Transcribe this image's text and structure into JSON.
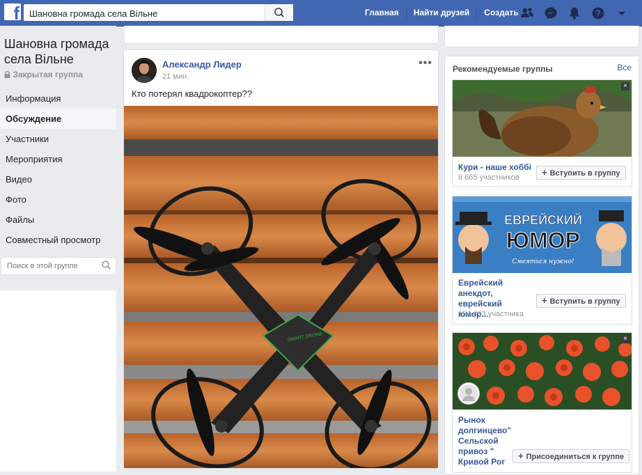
{
  "topbar": {
    "logo": "f",
    "search_value": "Шановна громада села Вільне",
    "nav": [
      "Главная",
      "Найти друзей",
      "Создать"
    ],
    "icons": [
      "friends-icon",
      "messenger-icon",
      "notifications-icon",
      "help-icon",
      "dropdown-icon"
    ]
  },
  "sidebar": {
    "group_title": "Шановна громада села Вільне",
    "group_type": "Закрытая группа",
    "menu": [
      "Информация",
      "Обсуждение",
      "Участники",
      "Мероприятия",
      "Видео",
      "Фото",
      "Файлы",
      "Совместный просмотр"
    ],
    "active_item": "Обсуждение",
    "search_placeholder": "Поиск в этой группе"
  },
  "post": {
    "author": "Александр Лидер",
    "timestamp": "21 мин.",
    "text": "Кто потерял квадрокоптер??",
    "more": "•••",
    "photo_label": "SMART DRONE"
  },
  "recommended": {
    "title": "Рекомендуемые группы",
    "see_all": "Все",
    "cards": [
      {
        "name": "Кури - наше хоббі",
        "members": "6 665 участников",
        "join": "Вступить в группу"
      },
      {
        "name": "Еврейский анекдот, еврейский юмор...",
        "members": "154 403 участника",
        "join": "Вступить в группу",
        "banner_title_1": "ЕВРЕЙСКИЙ",
        "banner_title_2": "ЮМОР",
        "banner_sub": "Смеяться нужно!"
      },
      {
        "name": "Рынок долгинцево\" Сельской привоз \" Кривой Рог",
        "join": "Присоединиться к группе"
      }
    ]
  },
  "colors": {
    "brand": "#4267b2",
    "link": "#365899",
    "background": "#e9ebee"
  }
}
